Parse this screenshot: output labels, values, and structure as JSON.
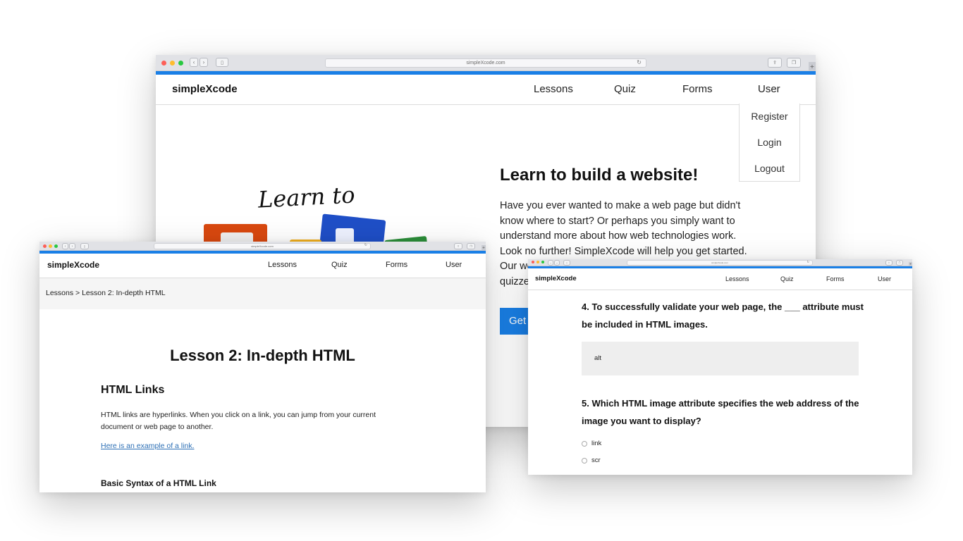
{
  "main_window": {
    "url": "simpleXcode.com",
    "reload_icon": "reload-icon",
    "brand": "simpleXcode",
    "nav": [
      "Lessons",
      "Quiz",
      "Forms",
      "User"
    ],
    "user_menu": [
      "Register",
      "Login",
      "Logout"
    ],
    "hero": {
      "decor_text": "Learn to",
      "title": "Learn to build a website!",
      "text": "Have you ever wanted to make a web page but didn't know where to start? Or perhaps you simply want to understand more about how web technologies work. Look no further! SimpleXcode will help you get started. Our we",
      "text_tail": "quizze",
      "cta": "Get"
    }
  },
  "lesson_window": {
    "url": "simpleXcode.com",
    "brand": "simpleXcode",
    "nav": [
      "Lessons",
      "Quiz",
      "Forms",
      "User"
    ],
    "breadcrumb": "Lessons > Lesson 2: In-depth HTML",
    "title": "Lesson 2: In-depth HTML",
    "section_heading": "HTML Links",
    "paragraph": "HTML links are hyperlinks. When you click on a link, you can jump from your current document or web page to another.",
    "example_link": "Here is an example of a link.",
    "subheading": "Basic Syntax of a HTML Link"
  },
  "quiz_window": {
    "url": "simpleXcode.com",
    "brand": "simpleXcode",
    "nav": [
      "Lessons",
      "Quiz",
      "Forms",
      "User"
    ],
    "q4": "4. To successfully validate your web page, the ___ attribute must be included in HTML images.",
    "q4_answer": "alt",
    "q5": "5. Which HTML image attribute specifies the web address of the image you want to display?",
    "q5_options": [
      "link",
      "scr"
    ]
  },
  "colors": {
    "accent": "#1a7fe6",
    "close": "#fd5f57",
    "minimize": "#febc2e",
    "zoom": "#28c840"
  }
}
